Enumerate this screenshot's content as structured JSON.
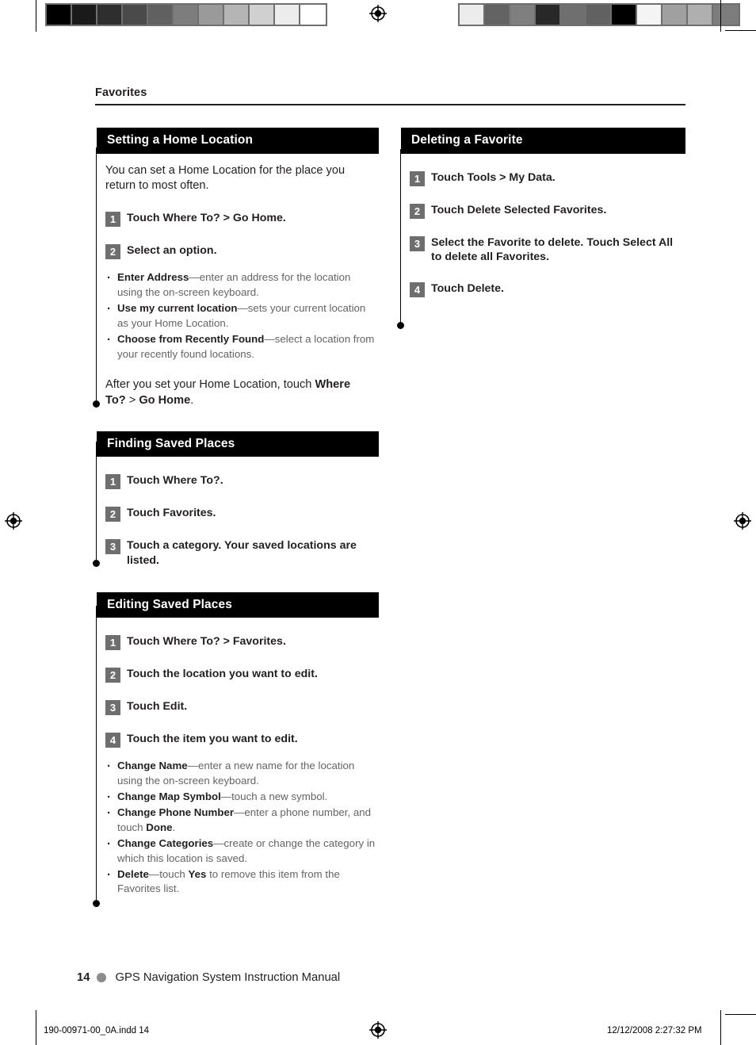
{
  "press_marks": {
    "left_swatches": [
      "#000000",
      "#1a1a1a",
      "#2e2e2e",
      "#4a4a4a",
      "#606060",
      "#7d7d7d",
      "#9a9a9a",
      "#b5b5b5",
      "#d0d0d0",
      "#ececec",
      "#ffffff"
    ],
    "right_swatches": [
      "#ececec",
      "#636363",
      "#7f7f7f",
      "#282828",
      "#6f6f6f",
      "#616161",
      "#000000",
      "#f4f4f4",
      "#a0a0a0",
      "#afafaf",
      "#7c7c7c"
    ],
    "registration_icon": "registration-target-icon"
  },
  "running_head": "Favorites",
  "columns": {
    "left": [
      {
        "id": "setting-a-home-location",
        "title": "Setting a Home Location",
        "intro": "You can set a Home Location for the place you return to most often.",
        "steps": [
          {
            "num": "1",
            "text": "Touch Where To? > Go Home."
          },
          {
            "num": "2",
            "text": "Select an option."
          }
        ],
        "bullets": [
          {
            "term": "Enter Address",
            "desc": "—enter an address for the location using the on-screen keyboard."
          },
          {
            "term": "Use my current location",
            "desc": "—sets your current location as your Home Location."
          },
          {
            "term": "Choose from Recently Found",
            "desc": "—select a location from your recently found locations."
          }
        ],
        "after_note_parts": [
          {
            "text": "After you set your Home Location, touch ",
            "bold": false
          },
          {
            "text": "Where To?",
            "bold": true
          },
          {
            "text": " > ",
            "bold": false
          },
          {
            "text": "Go Home",
            "bold": true
          },
          {
            "text": ".",
            "bold": false
          }
        ]
      },
      {
        "id": "finding-saved-places",
        "title": "Finding Saved Places",
        "steps": [
          {
            "num": "1",
            "text": "Touch Where To?."
          },
          {
            "num": "2",
            "text": "Touch Favorites."
          },
          {
            "num": "3",
            "text": "Touch a category. Your saved locations are listed."
          }
        ]
      },
      {
        "id": "editing-saved-places",
        "title": "Editing Saved Places",
        "steps": [
          {
            "num": "1",
            "text": "Touch Where To? > Favorites."
          },
          {
            "num": "2",
            "text": "Touch the location you want to edit."
          },
          {
            "num": "3",
            "text": "Touch Edit."
          },
          {
            "num": "4",
            "text": "Touch the item you want to edit."
          }
        ],
        "bullets": [
          {
            "term": "Change Name",
            "desc": "—enter a new name for the location using the on-screen keyboard."
          },
          {
            "term": "Change Map Symbol",
            "desc": "—touch a new symbol."
          },
          {
            "term": "Change Phone Number",
            "desc": "—enter a phone number, and touch ",
            "tail_bold": "Done",
            "tail": "."
          },
          {
            "term": "Change Categories",
            "desc": "—create or change the category in which this location is saved."
          },
          {
            "term": "Delete",
            "desc": "—touch ",
            "tail_bold": "Yes",
            "tail": " to remove this item from the Favorites list."
          }
        ]
      }
    ],
    "right": [
      {
        "id": "deleting-a-favorite",
        "title": "Deleting a Favorite",
        "steps": [
          {
            "num": "1",
            "text": "Touch Tools > My Data."
          },
          {
            "num": "2",
            "text": "Touch Delete Selected Favorites."
          },
          {
            "num": "3",
            "text": "Select the Favorite to delete. Touch Select All to delete all Favorites."
          },
          {
            "num": "4",
            "text": "Touch Delete."
          }
        ]
      }
    ]
  },
  "footer": {
    "page_number": "14",
    "title": "GPS Navigation System Instruction Manual"
  },
  "slug": {
    "file": "190-00971-00_0A.indd   14",
    "stamp": "12/12/2008   2:27:32 PM"
  }
}
